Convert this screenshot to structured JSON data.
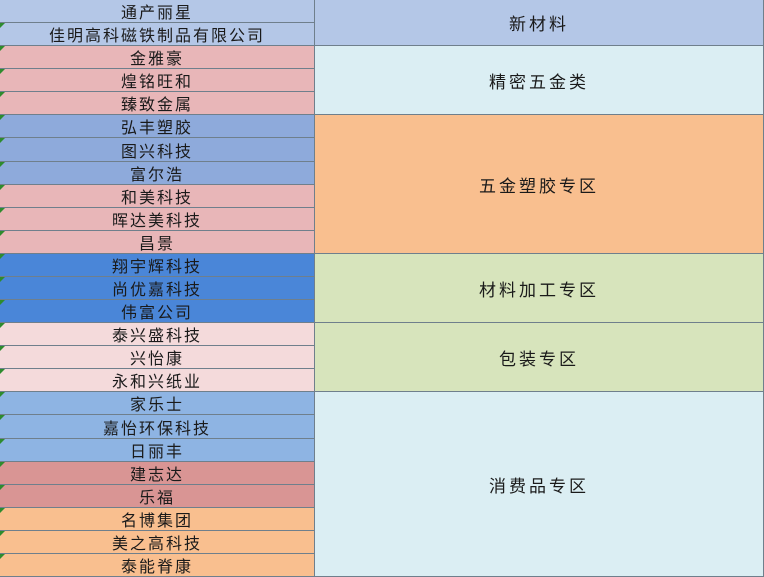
{
  "companies": [
    {
      "name": "通产丽星",
      "color": "#b4c7e7",
      "marker": false
    },
    {
      "name": "佳明高科磁铁制品有限公司",
      "color": "#b4c7e7",
      "marker": true
    },
    {
      "name": "金雅豪",
      "color": "#e8b6b8",
      "marker": true
    },
    {
      "name": "煌铭旺和",
      "color": "#e8b6b8",
      "marker": true
    },
    {
      "name": "臻致金属",
      "color": "#e8b6b8",
      "marker": true
    },
    {
      "name": "弘丰塑胶",
      "color": "#8eaadb",
      "marker": true
    },
    {
      "name": "图兴科技",
      "color": "#8eaadb",
      "marker": true
    },
    {
      "name": "富尔浩",
      "color": "#8eaadb",
      "marker": true
    },
    {
      "name": "和美科技",
      "color": "#e8b6b8",
      "marker": true
    },
    {
      "name": "晖达美科技",
      "color": "#e8b6b8",
      "marker": true
    },
    {
      "name": "昌景",
      "color": "#e8b6b8",
      "marker": true
    },
    {
      "name": "翔宇辉科技",
      "color": "#4a86d8",
      "marker": true
    },
    {
      "name": "尚优嘉科技",
      "color": "#4a86d8",
      "marker": true
    },
    {
      "name": "伟富公司",
      "color": "#4a86d8",
      "marker": true
    },
    {
      "name": "泰兴盛科技",
      "color": "#f4dadb",
      "marker": true
    },
    {
      "name": "兴怡康",
      "color": "#f4dadb",
      "marker": true
    },
    {
      "name": "永和兴纸业",
      "color": "#f4dadb",
      "marker": true
    },
    {
      "name": "家乐士",
      "color": "#8eb4e3",
      "marker": true
    },
    {
      "name": "嘉怡环保科技",
      "color": "#8eb4e3",
      "marker": true
    },
    {
      "name": "日丽丰",
      "color": "#8eb4e3",
      "marker": true
    },
    {
      "name": "建志达",
      "color": "#d99594",
      "marker": true
    },
    {
      "name": "乐福",
      "color": "#d99594",
      "marker": true
    },
    {
      "name": "名博集团",
      "color": "#f9bf8f",
      "marker": true
    },
    {
      "name": "美之高科技",
      "color": "#f9bf8f",
      "marker": true
    },
    {
      "name": "泰能脊康",
      "color": "#f9bf8f",
      "marker": true
    }
  ],
  "categories": [
    {
      "name": "新材料",
      "rows": 2,
      "color": "#b4c7e7"
    },
    {
      "name": "精密五金类",
      "rows": 3,
      "color": "#dbeef3"
    },
    {
      "name": "五金塑胶专区",
      "rows": 6,
      "color": "#f9bf8f"
    },
    {
      "name": "材料加工专区",
      "rows": 3,
      "color": "#d7e4bc"
    },
    {
      "name": "包装专区",
      "rows": 3,
      "color": "#d7e4bc"
    },
    {
      "name": "消费品专区",
      "rows": 8,
      "color": "#dbeef3"
    }
  ]
}
